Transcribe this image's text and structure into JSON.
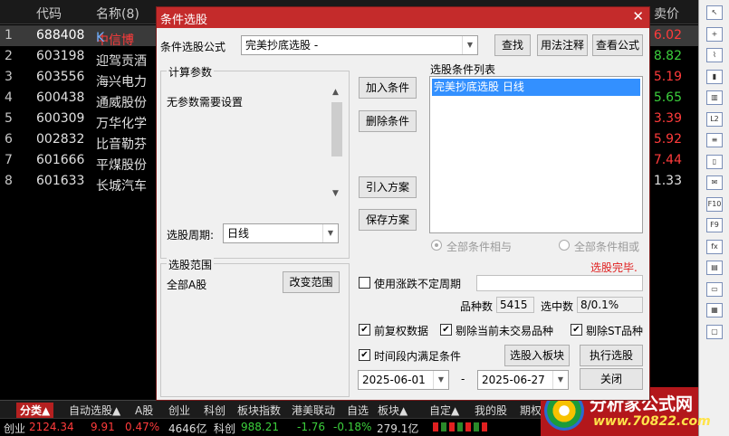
{
  "table": {
    "headers": {
      "code": "代码",
      "name": "名称(8)",
      "price": "卖价"
    },
    "rows": [
      {
        "idx": "1",
        "code": "688408",
        "name": "中信博",
        "badge": "K",
        "price": "6.02",
        "price_color": "#ff3b3b"
      },
      {
        "idx": "2",
        "code": "603198",
        "name": "迎驾贡酒",
        "badge": "",
        "price": "8.82",
        "price_color": "#3ccf3c"
      },
      {
        "idx": "3",
        "code": "603556",
        "name": "海兴电力",
        "badge": "",
        "price": "5.19",
        "price_color": "#ff3b3b"
      },
      {
        "idx": "4",
        "code": "600438",
        "name": "通威股份",
        "badge": "",
        "price": "5.65",
        "price_color": "#3ccf3c"
      },
      {
        "idx": "5",
        "code": "600309",
        "name": "万华化学",
        "badge": "",
        "price": "3.39",
        "price_color": "#ff3b3b"
      },
      {
        "idx": "6",
        "code": "002832",
        "name": "比音勒芬",
        "badge": "",
        "price": "5.92",
        "price_color": "#ff3b3b"
      },
      {
        "idx": "7",
        "code": "601666",
        "name": "平煤股份",
        "badge": "",
        "price": "7.44",
        "price_color": "#ff3b3b"
      },
      {
        "idx": "8",
        "code": "601633",
        "name": "长城汽车",
        "badge": "",
        "price": "1.33",
        "price_color": "#e0e0e0"
      }
    ]
  },
  "dialog": {
    "title": "条件选股",
    "close_glyph": "✕",
    "formula_label": "条件选股公式",
    "formula_value": "完美抄底选股  -",
    "find_label": "查找",
    "usage_label": "用法注释",
    "view_formula_label": "查看公式",
    "params_title": "计算参数",
    "params_text": "无参数需要设置",
    "period_label": "选股周期:",
    "period_value": "日线",
    "add_label": "加入条件",
    "delete_label": "删除条件",
    "import_label": "引入方案",
    "save_label": "保存方案",
    "conditions_title": "选股条件列表",
    "conditions": [
      "完美抄底选股  日线"
    ],
    "all_and_label": "全部条件相与",
    "all_or_label": "全部条件相或",
    "status_text": "选股完毕.",
    "range_title": "选股范围",
    "range_value": "全部A股",
    "change_range_label": "改变范围",
    "use_rise_fall_label": "使用涨跌不定周期",
    "count_label": "品种数",
    "count_value": "5415",
    "hit_label": "选中数",
    "hit_value": "8/0.1%",
    "pre_adjust_label": "前复权数据",
    "exclude_unlisted_label": "剔除当前未交易品种",
    "exclude_st_label": "剔除ST品种",
    "time_range_label": "时间段内满足条件",
    "select_to_board_label": "选股入板块",
    "execute_label": "执行选股",
    "date_from": "2025-06-01",
    "date_sep": "-",
    "date_to": "2025-06-27",
    "close_label": "关闭"
  },
  "bottom_tabs": [
    "分类▲",
    "自动选股▲",
    "A股",
    "创业",
    "科创",
    "板块指数",
    "港美联动",
    "自选",
    "板块▲",
    "自定▲",
    "我的股",
    "期权"
  ],
  "status_bar": {
    "index1_name": "创业",
    "index1_value": "2124.34",
    "index1_change": "9.91",
    "index1_pct": "0.47%",
    "index1_amount": "4646亿",
    "index2_name": "科创",
    "index2_value": "988.21",
    "index2_change": "-1.76",
    "index2_pct": "-0.18%",
    "index2_amount": "279.1亿"
  },
  "logo": {
    "title": "分析家公式网",
    "url": "www.70822.com"
  },
  "toolbar_icons": [
    "arrow-icon",
    "plus-icon",
    "timeline-icon",
    "kline-icon",
    "bars-icon",
    "level2-icon",
    "list-icon",
    "candle-icon",
    "news-icon",
    "f10-icon",
    "f9-icon",
    "fx-icon",
    "doc-icon",
    "folder-icon",
    "grid-icon",
    "window-icon"
  ],
  "colors": {
    "title_bar": "#c42b2b",
    "selected_list": "#3390ff",
    "status_text": "#e02020",
    "up": "#ff3b3b",
    "down": "#3ccf3c"
  }
}
